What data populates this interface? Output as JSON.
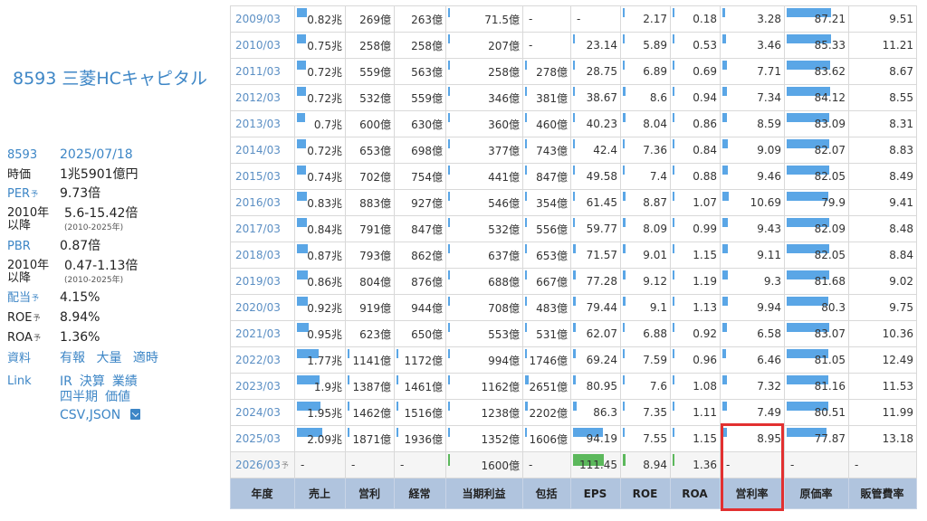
{
  "company": {
    "title": "8593 三菱HCキャピタル"
  },
  "info": {
    "code": "8593",
    "date": "2025/07/18",
    "price_label": "時価",
    "price_value": "1兆5901億円",
    "per_label": "PER",
    "yo": "予",
    "per_value": "9.73倍",
    "since_label": "2010年\n以降",
    "per_range": "5.6-15.42倍",
    "range_years": "(2010-2025年)",
    "pbr_label": "PBR",
    "pbr_value": "0.87倍",
    "pbr_range": "0.47-1.13倍",
    "div_label": "配当",
    "div_value": "4.15%",
    "roe_label": "ROE",
    "roe_value": "8.94%",
    "roa_label": "ROA",
    "roa_value": "1.36%",
    "docs_label": "資料",
    "docs_links": [
      "有報",
      "大量",
      "適時"
    ],
    "link_label": "Link",
    "link_row1": [
      "IR",
      "決算",
      "業績"
    ],
    "link_row2": [
      "四半期",
      "価値"
    ],
    "link_csv": "CSV,JSON"
  },
  "table": {
    "headers": [
      "年度",
      "売上",
      "営利",
      "経常",
      "当期利益",
      "包括",
      "EPS",
      "ROE",
      "ROA",
      "営利率",
      "原価率",
      "販管費率"
    ],
    "rows": [
      {
        "year": "2009/03",
        "c": [
          "0.82兆",
          "269億",
          "263億",
          "71.5億",
          "-",
          "-",
          "2.17",
          "0.18",
          "3.28",
          "87.21",
          "9.51"
        ],
        "bars": [
          0.22,
          0,
          0,
          0.01,
          0,
          0,
          0.02,
          0.02,
          0.05,
          0.76,
          0
        ]
      },
      {
        "year": "2010/03",
        "c": [
          "0.75兆",
          "258億",
          "258億",
          "207億",
          "-",
          "23.14",
          "5.89",
          "0.53",
          "3.46",
          "85.33",
          "11.21"
        ],
        "bars": [
          0.2,
          0,
          0,
          0.01,
          0,
          0.02,
          0.05,
          0.02,
          0.06,
          0.75,
          0
        ]
      },
      {
        "year": "2011/03",
        "c": [
          "0.72兆",
          "559億",
          "563億",
          "258億",
          "278億",
          "28.75",
          "6.89",
          "0.69",
          "7.71",
          "83.62",
          "8.67"
        ],
        "bars": [
          0.19,
          0,
          0,
          0.01,
          0.02,
          0.03,
          0.05,
          0.02,
          0.08,
          0.74,
          0
        ]
      },
      {
        "year": "2012/03",
        "c": [
          "0.72兆",
          "532億",
          "559億",
          "346億",
          "381億",
          "38.67",
          "8.6",
          "0.94",
          "7.34",
          "84.12",
          "8.55"
        ],
        "bars": [
          0.19,
          0,
          0,
          0.01,
          0.02,
          0.04,
          0.06,
          0.02,
          0.08,
          0.74,
          0
        ]
      },
      {
        "year": "2013/03",
        "c": [
          "0.7兆",
          "600億",
          "630億",
          "360億",
          "460億",
          "40.23",
          "8.04",
          "0.86",
          "8.59",
          "83.09",
          "8.31"
        ],
        "bars": [
          0.18,
          0,
          0,
          0.01,
          0.02,
          0.04,
          0.06,
          0.02,
          0.08,
          0.73,
          0
        ]
      },
      {
        "year": "2014/03",
        "c": [
          "0.72兆",
          "653億",
          "698億",
          "377億",
          "743億",
          "42.4",
          "7.36",
          "0.84",
          "9.09",
          "82.07",
          "8.83"
        ],
        "bars": [
          0.19,
          0,
          0,
          0.01,
          0.03,
          0.04,
          0.05,
          0.02,
          0.09,
          0.72,
          0
        ]
      },
      {
        "year": "2015/03",
        "c": [
          "0.74兆",
          "702億",
          "754億",
          "441億",
          "847億",
          "49.58",
          "7.4",
          "0.88",
          "9.46",
          "82.05",
          "8.49"
        ],
        "bars": [
          0.2,
          0,
          0,
          0.01,
          0.03,
          0.05,
          0.05,
          0.02,
          0.09,
          0.72,
          0
        ]
      },
      {
        "year": "2016/03",
        "c": [
          "0.83兆",
          "883億",
          "927億",
          "546億",
          "354億",
          "61.45",
          "8.87",
          "1.07",
          "10.69",
          "79.9",
          "9.41"
        ],
        "bars": [
          0.22,
          0,
          0,
          0.01,
          0.02,
          0.05,
          0.06,
          0.02,
          0.1,
          0.7,
          0
        ]
      },
      {
        "year": "2017/03",
        "c": [
          "0.84兆",
          "791億",
          "847億",
          "532億",
          "556億",
          "59.77",
          "8.09",
          "0.99",
          "9.43",
          "82.09",
          "8.48"
        ],
        "bars": [
          0.22,
          0,
          0,
          0.01,
          0.02,
          0.05,
          0.06,
          0.02,
          0.09,
          0.72,
          0
        ]
      },
      {
        "year": "2018/03",
        "c": [
          "0.87兆",
          "793億",
          "862億",
          "637億",
          "653億",
          "71.57",
          "9.01",
          "1.15",
          "9.11",
          "82.05",
          "8.84"
        ],
        "bars": [
          0.23,
          0,
          0,
          0.01,
          0.03,
          0.06,
          0.06,
          0.02,
          0.09,
          0.72,
          0
        ]
      },
      {
        "year": "2019/03",
        "c": [
          "0.86兆",
          "804億",
          "876億",
          "688億",
          "667億",
          "77.28",
          "9.12",
          "1.19",
          "9.3",
          "81.68",
          "9.02"
        ],
        "bars": [
          0.23,
          0,
          0,
          0.01,
          0.03,
          0.07,
          0.06,
          0.02,
          0.09,
          0.72,
          0
        ]
      },
      {
        "year": "2020/03",
        "c": [
          "0.92兆",
          "919億",
          "944億",
          "708億",
          "483億",
          "79.44",
          "9.1",
          "1.13",
          "9.94",
          "80.3",
          "9.75"
        ],
        "bars": [
          0.24,
          0,
          0,
          0.01,
          0.02,
          0.07,
          0.06,
          0.02,
          0.09,
          0.7,
          0
        ]
      },
      {
        "year": "2021/03",
        "c": [
          "0.95兆",
          "623億",
          "650億",
          "553億",
          "531億",
          "62.07",
          "6.88",
          "0.92",
          "6.58",
          "83.07",
          "10.36"
        ],
        "bars": [
          0.25,
          0,
          0,
          0.01,
          0.02,
          0.06,
          0.05,
          0.02,
          0.07,
          0.73,
          0
        ]
      },
      {
        "year": "2022/03",
        "c": [
          "1.77兆",
          "1141億",
          "1172億",
          "994億",
          "1746億",
          "69.24",
          "7.59",
          "0.96",
          "6.46",
          "81.05",
          "12.49"
        ],
        "bars": [
          0.47,
          0.02,
          0.02,
          0.02,
          0.05,
          0.06,
          0.05,
          0.02,
          0.06,
          0.71,
          0
        ]
      },
      {
        "year": "2023/03",
        "c": [
          "1.9兆",
          "1387億",
          "1461億",
          "1162億",
          "2651億",
          "80.95",
          "7.6",
          "1.08",
          "7.32",
          "81.16",
          "11.53"
        ],
        "bars": [
          0.5,
          0.02,
          0.02,
          0.02,
          0.08,
          0.07,
          0.05,
          0.02,
          0.07,
          0.71,
          0
        ]
      },
      {
        "year": "2024/03",
        "c": [
          "1.95兆",
          "1462億",
          "1516億",
          "1238億",
          "2202億",
          "86.3",
          "7.35",
          "1.11",
          "7.49",
          "80.51",
          "11.99"
        ],
        "bars": [
          0.51,
          0.02,
          0.02,
          0.02,
          0.07,
          0.08,
          0.05,
          0.02,
          0.07,
          0.7,
          0
        ]
      },
      {
        "year": "2025/03",
        "c": [
          "2.09兆",
          "1871億",
          "1936億",
          "1352億",
          "1606億",
          "94.19",
          "7.55",
          "1.15",
          "8.95",
          "77.87",
          "13.18"
        ],
        "bars": [
          0.55,
          0.03,
          0.03,
          0.02,
          0.05,
          0.68,
          0.05,
          0.02,
          0.08,
          0.68,
          0
        ]
      },
      {
        "year": "2026/03",
        "forecast": true,
        "c": [
          "-",
          "-",
          "-",
          "1600億",
          "-",
          "111.45",
          "8.94",
          "1.36",
          "-",
          "-",
          "-"
        ],
        "bars": [
          0,
          0,
          0,
          0.03,
          0,
          0.7,
          0.06,
          0.03,
          0,
          0,
          0
        ]
      }
    ]
  }
}
